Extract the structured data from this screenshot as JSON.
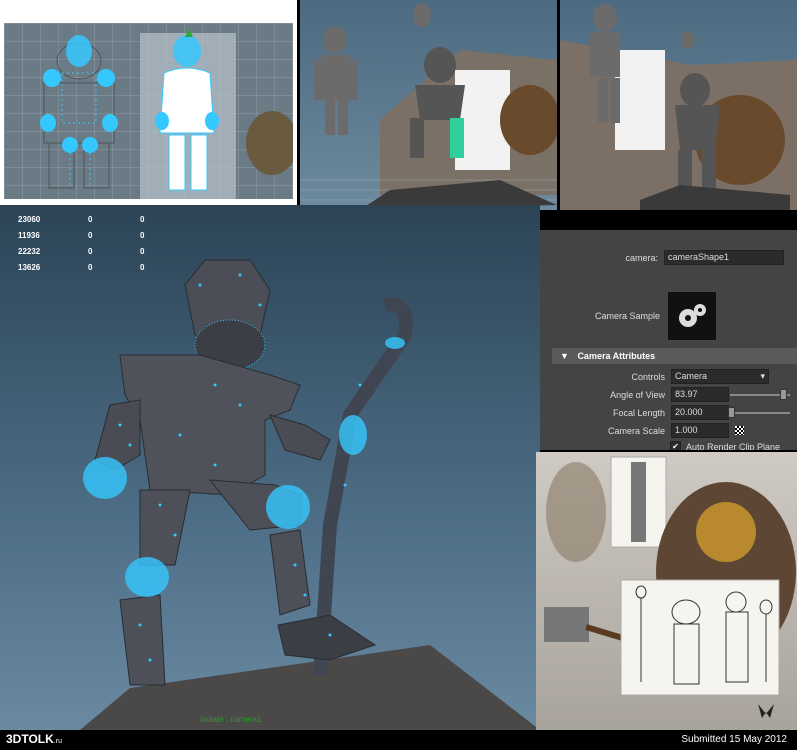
{
  "poly_stats": [
    {
      "a": "23060",
      "b": "0",
      "c": "0"
    },
    {
      "a": "11936",
      "b": "0",
      "c": "0"
    },
    {
      "a": "22232",
      "b": "0",
      "c": "0"
    },
    {
      "a": "13626",
      "b": "0",
      "c": "0"
    }
  ],
  "viewport_camera_label": "Isolate : camera1",
  "attribute_editor": {
    "camera_label": "camera:",
    "camera_value": "cameraShape1",
    "camera_sample_label": "Camera Sample",
    "section_title": "Camera Attributes",
    "controls_label": "Controls",
    "controls_value": "Camera",
    "angle_label": "Angle of View",
    "angle_value": "83.97",
    "focal_label": "Focal Length",
    "focal_value": "20.000",
    "scale_label": "Camera Scale",
    "scale_value": "1.000",
    "clip_label": "Auto Render Clip Plane",
    "clip_checked": true
  },
  "footer": {
    "site": "3DTOLK",
    "site_suffix": ".ru",
    "submitted": "Submitted 15 May 2012"
  },
  "colors": {
    "highlight": "#35c8ff",
    "viewport_bg": "#3d5a70",
    "panel_bg": "#444444"
  }
}
